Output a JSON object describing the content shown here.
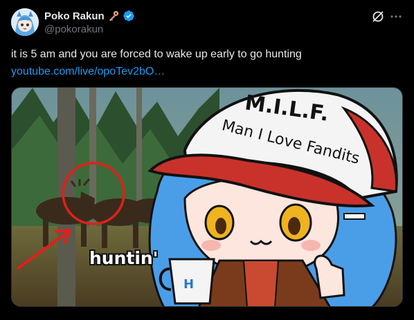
{
  "author": {
    "display_name": "Poko Rakun",
    "handle": "@pokorakun",
    "badges": [
      "key-icon",
      "verified-icon"
    ]
  },
  "post": {
    "text": "it is 5 am and you are forced to wake up early to go hunting",
    "link": "youtube.com/live/opoTev2bO…"
  },
  "media": {
    "cap_text_line1": "M.I.L.F.",
    "cap_text_line2": "Man I Love Fandits",
    "caption": "huntin'"
  },
  "actions": {
    "grok_icon": "grok-icon",
    "more_icon": "more-icon"
  },
  "colors": {
    "link": "#1d9bf0",
    "verified": "#1d9bf0",
    "cap_red": "#c8322a",
    "hair_blue": "#4a9ee8",
    "circle_red": "#e0201a"
  }
}
